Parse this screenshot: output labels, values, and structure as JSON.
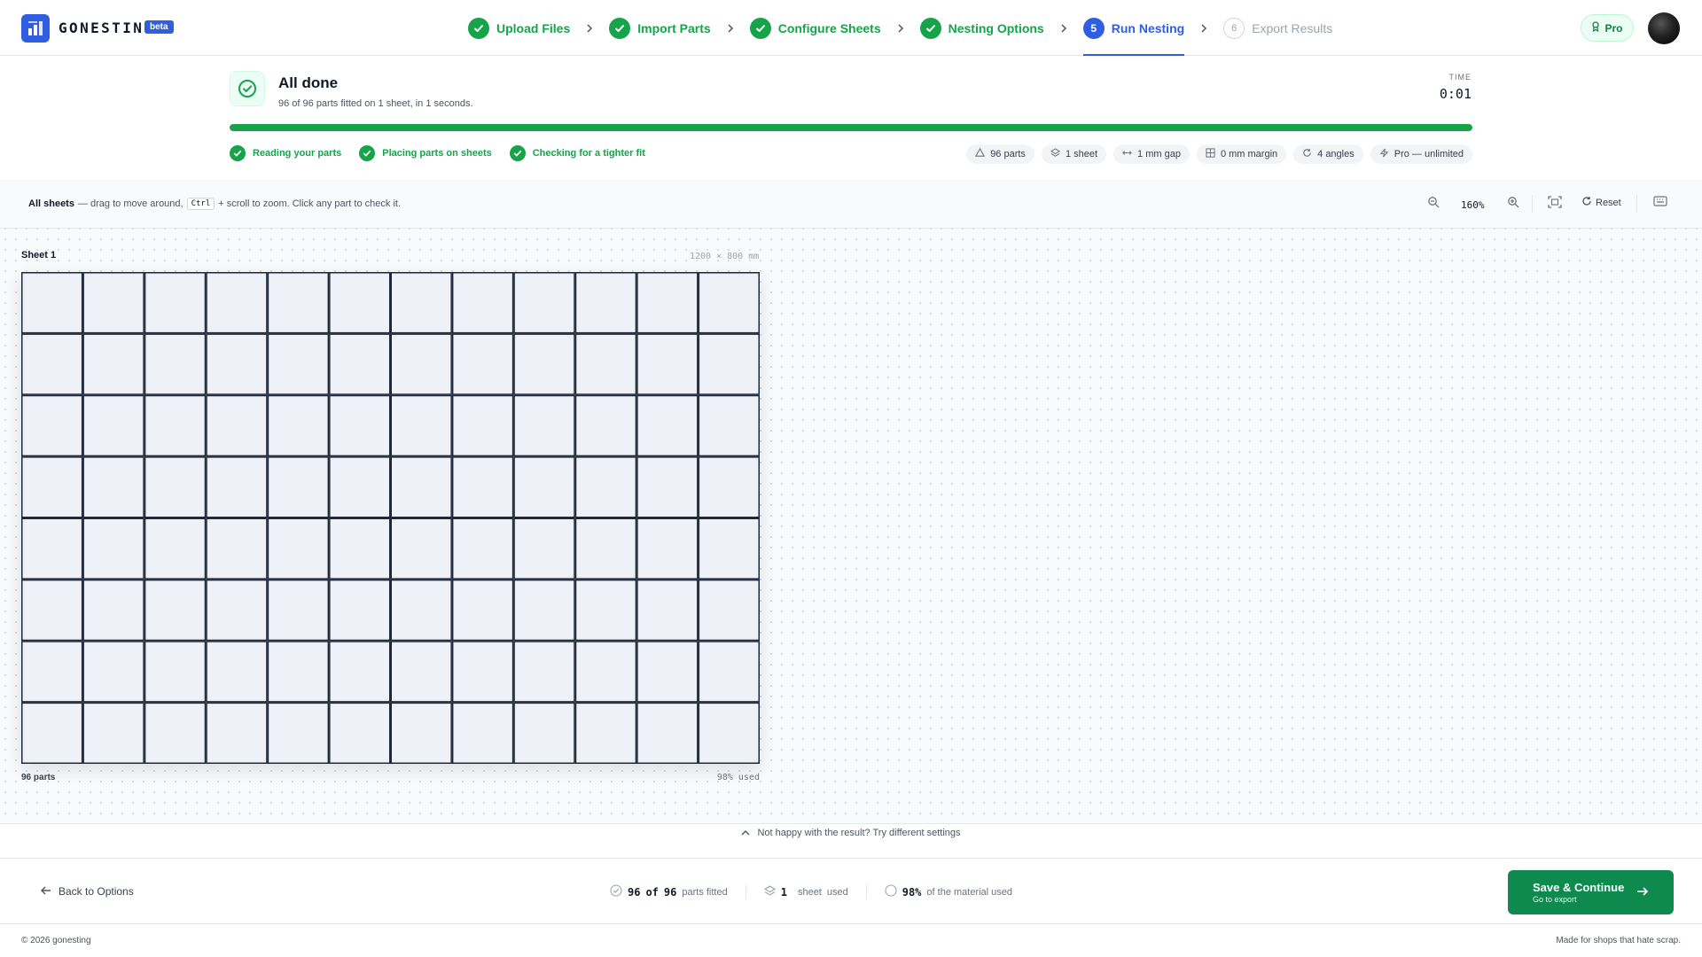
{
  "header": {
    "brand": "GONESTING",
    "badge": "beta",
    "steps": [
      {
        "label": "Upload Files",
        "state": "done"
      },
      {
        "label": "Import Parts",
        "state": "done"
      },
      {
        "label": "Configure Sheets",
        "state": "done"
      },
      {
        "label": "Nesting Options",
        "state": "done"
      },
      {
        "number": "5",
        "label": "Run Nesting",
        "state": "active"
      },
      {
        "number": "6",
        "label": "Export Results",
        "state": "pending"
      }
    ],
    "pro_label": "Pro"
  },
  "status": {
    "title": "All done",
    "subtitle": "96 of 96 parts fitted on 1 sheet, in 1 seconds.",
    "time_label": "TIME",
    "time_value": "0:01",
    "progress_percent": 100,
    "phases": [
      "Reading your parts",
      "Placing parts on sheets",
      "Checking for a tighter fit"
    ],
    "chips": [
      {
        "icon": "parts-icon",
        "label": "96 parts"
      },
      {
        "icon": "layers-icon",
        "label": "1 sheet"
      },
      {
        "icon": "gap-icon",
        "label": "1 mm gap"
      },
      {
        "icon": "margin-icon",
        "label": "0 mm margin"
      },
      {
        "icon": "rotate-icon",
        "label": "4 angles"
      },
      {
        "icon": "bolt-icon",
        "label": "Pro — unlimited"
      }
    ]
  },
  "toolbar": {
    "hint_bold": "All sheets",
    "hint_text_1": "— drag to move around,",
    "hint_key": "Ctrl",
    "hint_text_2": "+ scroll to zoom. Click any part to check it.",
    "zoom": "160%",
    "reset_label": "Reset"
  },
  "sheet": {
    "title": "Sheet 1",
    "dims": "1200 × 800 mm",
    "parts_label": "96 parts",
    "used_label": "98% used",
    "grid": {
      "columns": 12,
      "rows": 8
    },
    "colors": {
      "part_fill": "#eef1f7",
      "part_stroke": "#1f2937"
    }
  },
  "retry_text": "Not happy with the result? Try different settings",
  "actions": {
    "back_label": "Back to Options",
    "fitted_value": "96",
    "fitted_of": "of",
    "fitted_total": "96",
    "fitted_label": "parts fitted",
    "sheets_value": "1",
    "sheets_label_1": "sheet",
    "sheets_label_2": "used",
    "material_value": "98%",
    "material_label": "of the material used",
    "save_main": "Save & Continue",
    "save_sub": "Go to export"
  },
  "footer": {
    "copyright": "© 2026 gonesting",
    "tagline": "Made for shops that hate scrap."
  },
  "colors": {
    "accent": "#2f5fe0",
    "success": "#16a34a",
    "save": "#0f8a4f"
  }
}
